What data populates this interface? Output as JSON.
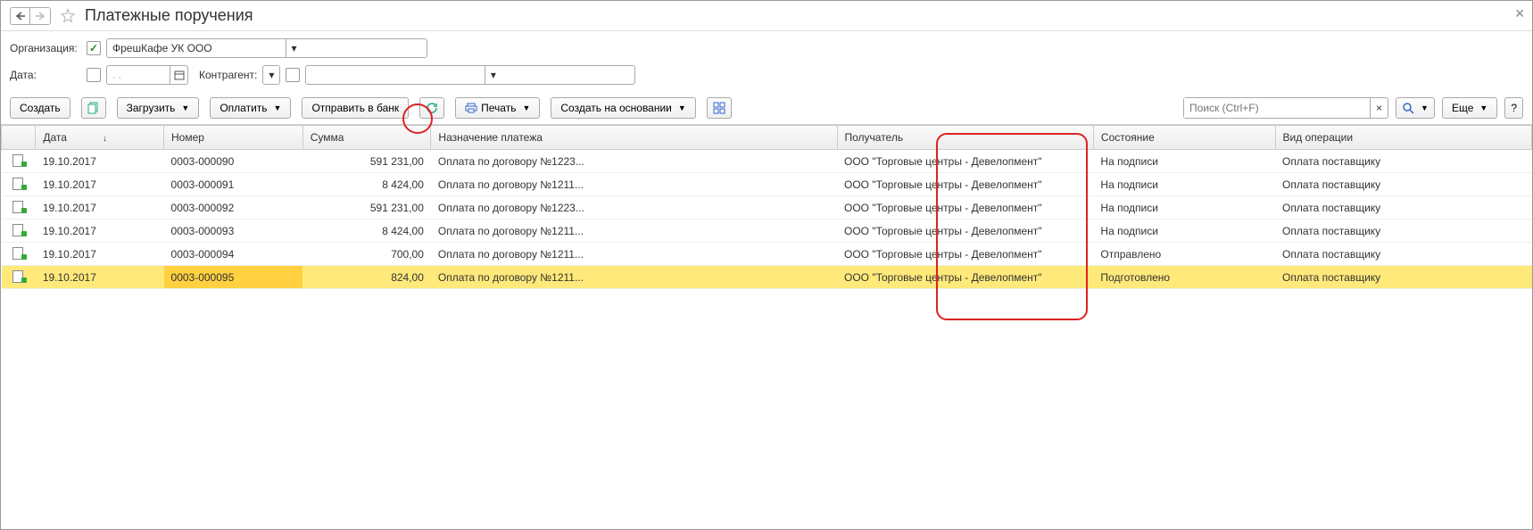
{
  "header": {
    "title": "Платежные поручения"
  },
  "filters": {
    "org_label": "Организация:",
    "org_value": "ФрешКафе УК ООО",
    "date_label": "Дата:",
    "date_placeholder": ". .",
    "counterparty_label": "Контрагент:"
  },
  "toolbar": {
    "create": "Создать",
    "load": "Загрузить",
    "pay": "Оплатить",
    "send_to_bank": "Отправить в банк",
    "print": "Печать",
    "create_based_on": "Создать на основании",
    "search_placeholder": "Поиск (Ctrl+F)",
    "more": "Еще",
    "help": "?"
  },
  "columns": {
    "date": "Дата",
    "number": "Номер",
    "sum": "Сумма",
    "purpose": "Назначение платежа",
    "recipient": "Получатель",
    "status": "Состояние",
    "operation": "Вид операции"
  },
  "rows": [
    {
      "date": "19.10.2017",
      "number": "0003-000090",
      "sum": "591 231,00",
      "purpose": "Оплата по договору №1223...",
      "recipient": "ООО \"Торговые центры - Девелопмент\"",
      "status": "На подписи",
      "operation": "Оплата поставщику"
    },
    {
      "date": "19.10.2017",
      "number": "0003-000091",
      "sum": "8 424,00",
      "purpose": "Оплата по договору №1211...",
      "recipient": "ООО \"Торговые центры - Девелопмент\"",
      "status": "На подписи",
      "operation": "Оплата поставщику"
    },
    {
      "date": "19.10.2017",
      "number": "0003-000092",
      "sum": "591 231,00",
      "purpose": "Оплата по договору №1223...",
      "recipient": "ООО \"Торговые центры - Девелопмент\"",
      "status": "На подписи",
      "operation": "Оплата поставщику"
    },
    {
      "date": "19.10.2017",
      "number": "0003-000093",
      "sum": "8 424,00",
      "purpose": "Оплата по договору №1211...",
      "recipient": "ООО \"Торговые центры - Девелопмент\"",
      "status": "На подписи",
      "operation": "Оплата поставщику"
    },
    {
      "date": "19.10.2017",
      "number": "0003-000094",
      "sum": "700,00",
      "purpose": "Оплата по договору №1211...",
      "recipient": "ООО \"Торговые центры - Девелопмент\"",
      "status": "Отправлено",
      "operation": "Оплата поставщику"
    },
    {
      "date": "19.10.2017",
      "number": "0003-000095",
      "sum": "824,00",
      "purpose": "Оплата по договору №1211...",
      "recipient": "ООО \"Торговые центры - Девелопмент\"",
      "status": "Подготовлено",
      "operation": "Оплата поставщику"
    }
  ],
  "selected_index": 5
}
